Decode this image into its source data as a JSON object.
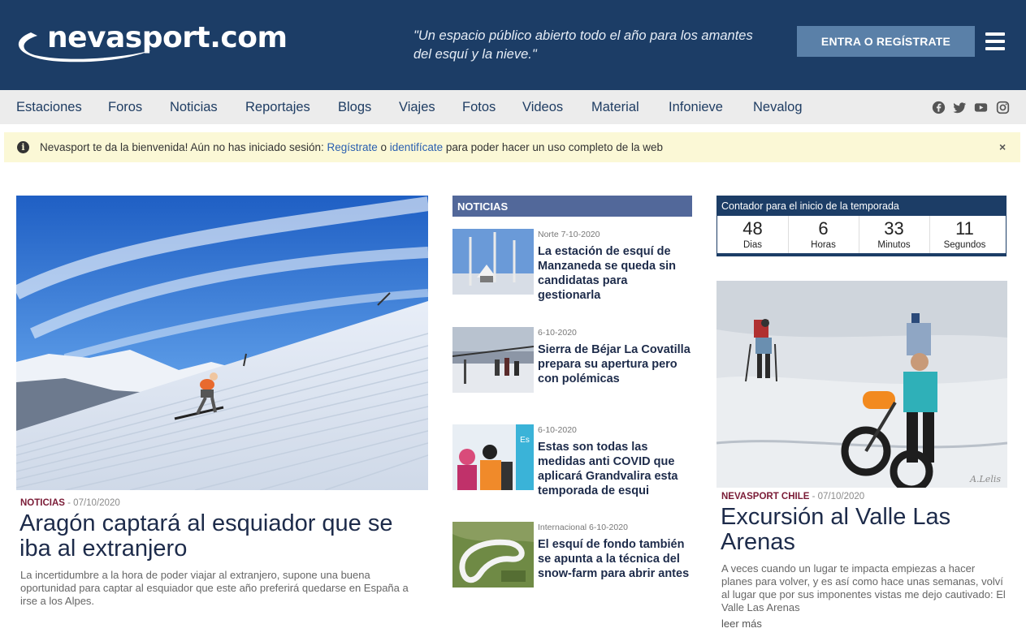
{
  "header": {
    "logo_text": "nevasport.com",
    "tagline": "\"Un espacio público abierto todo el año para los amantes del esquí y la nieve.\"",
    "login_button": "ENTRA O REGÍSTRATE"
  },
  "nav": {
    "items": [
      "Estaciones",
      "Foros",
      "Noticias",
      "Reportajes",
      "Blogs",
      "Viajes",
      "Fotos",
      "Videos",
      "Material",
      "Infonieve",
      "Nevalog"
    ],
    "social_icons": [
      "facebook-icon",
      "twitter-icon",
      "youtube-icon",
      "instagram-icon"
    ]
  },
  "notice": {
    "text_before": "Nevasport te da la bienvenida! Aún no has iniciado sesión: ",
    "link_register": "Regístrate",
    "text_or": " o ",
    "link_identify": "identifícate",
    "text_after": " para poder hacer un uso completo de la web",
    "close": "×"
  },
  "hero": {
    "category": "NOTICIAS",
    "date": " - 07/10/2020",
    "title": "Aragón captará al esquiador que se iba al extranjero",
    "description": "La incertidumbre a la hora de poder viajar al extranjero, supone una buena oportunidad para captar al esquiador que este año preferirá quedarse en España a irse a los Alpes."
  },
  "news": {
    "header": "NOTICIAS",
    "items": [
      {
        "meta": "Norte 7-10-2020",
        "title": "La estación de esquí de Manzaneda se queda sin candidatas para gestionarla"
      },
      {
        "meta": "6-10-2020",
        "title": "Sierra de Béjar La Covatilla prepara su apertura pero con polémicas"
      },
      {
        "meta": "6-10-2020",
        "title": "Estas son todas las medidas anti COVID que aplicará Grandvalira esta temporada de esqui"
      },
      {
        "meta": "Internacional 6-10-2020",
        "title": "El esquí de fondo también se apunta a la técnica del snow-farm para abrir antes"
      }
    ]
  },
  "countdown": {
    "title": "Contador para el inicio de la temporada",
    "cells": [
      {
        "value": "48",
        "label": "Dias"
      },
      {
        "value": "6",
        "label": "Horas"
      },
      {
        "value": "33",
        "label": "Minutos"
      },
      {
        "value": "11",
        "label": "Segundos"
      }
    ]
  },
  "side_article": {
    "category": "NEVASPORT CHILE",
    "date": " - 07/10/2020",
    "title": "Excursión al Valle Las Arenas",
    "description": "A veces cuando un lugar te impacta empiezas a hacer planes para volver, y es así como hace unas semanas, volví al lugar que por sus imponentes vistas me dejo cautivado: El Valle Las Arenas",
    "read_more": "leer más",
    "watermark": "A.Lelis"
  },
  "colors": {
    "header_bg": "#1c3d66",
    "accent_button": "#5a80a8",
    "category": "#7a1b36",
    "section_header": "#52689a",
    "notice_bg": "#fbf8d6"
  }
}
